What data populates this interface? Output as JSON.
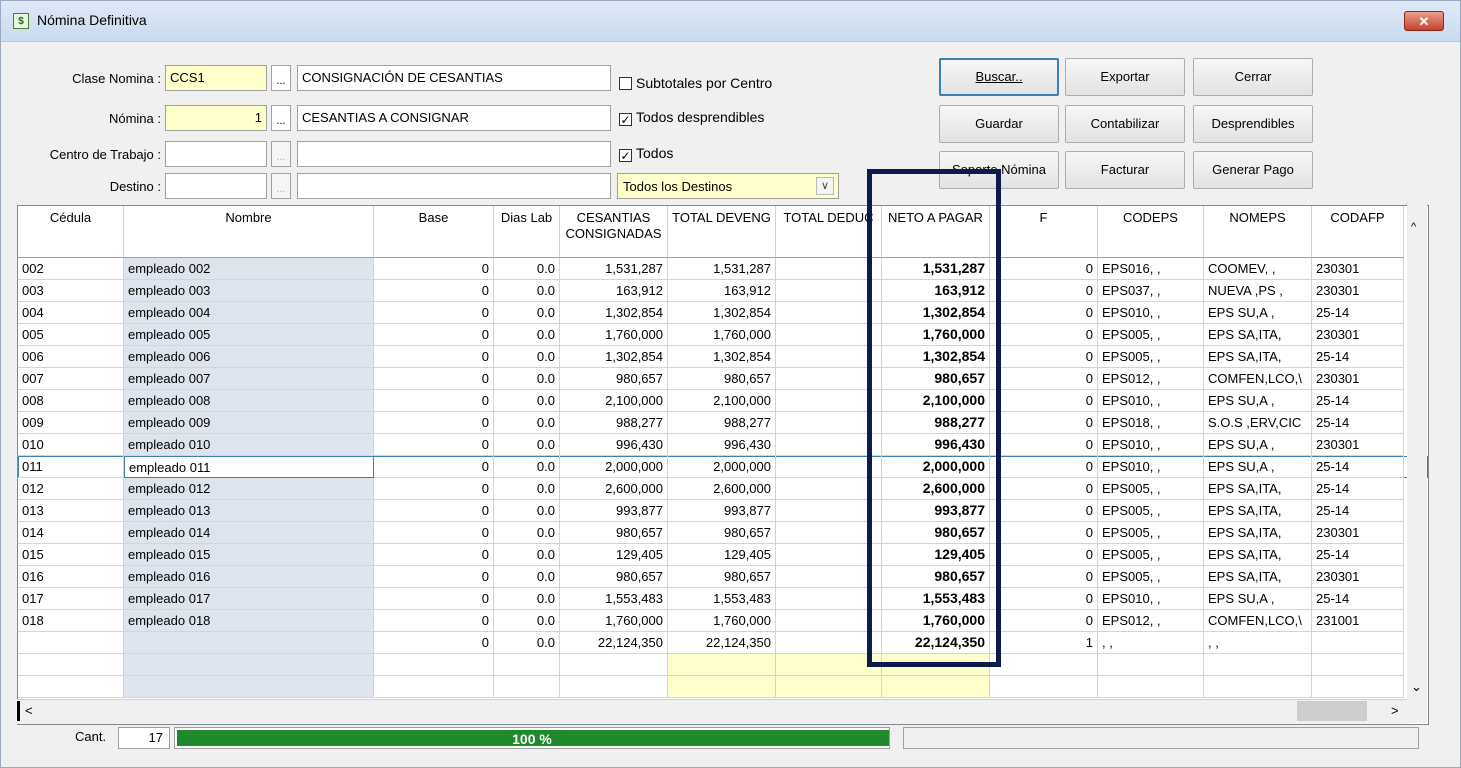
{
  "window": {
    "title": "Nómina Definitiva",
    "close_glyph": "✕"
  },
  "form": {
    "clase_label": "Clase Nomina :",
    "clase_code": "CCS1",
    "clase_desc": "CONSIGNACIÓN DE CESANTIAS",
    "nomina_label": "Nómina :",
    "nomina_code": "1",
    "nomina_desc": "CESANTIAS A CONSIGNAR",
    "centro_label": "Centro de Trabajo :",
    "centro_code": "",
    "centro_desc": "",
    "destino_label": "Destino :",
    "destino_code": "",
    "destino_desc": "",
    "dots": "...",
    "subtotales_label": "Subtotales por Centro",
    "subtotales_checked": false,
    "desprendibles_label": "Todos desprendibles",
    "desprendibles_checked": true,
    "todos_label": "Todos",
    "todos_checked": true,
    "destinos_value": "Todos los Destinos",
    "check_glyph": "✓"
  },
  "buttons": {
    "buscar": "Buscar..",
    "exportar": "Exportar",
    "cerrar": "Cerrar",
    "guardar": "Guardar",
    "contabilizar": "Contabilizar",
    "desprendibles": "Desprendibles",
    "soporte": "Soporte Nómina",
    "facturar": "Facturar",
    "generar_pago": "Generar Pago"
  },
  "table": {
    "columns": [
      "Cédula",
      "Nombre",
      "Base",
      "Dias Lab",
      "CESANTIAS\nCONSIGNADAS",
      "TOTAL DEVENG",
      "TOTAL DEDUC",
      "NETO A PAGAR",
      "F",
      "CODEPS",
      "NOMEPS",
      "CODAFP"
    ],
    "rows": [
      [
        "002",
        "empleado 002",
        "0",
        "0.0",
        "1,531,287",
        "1,531,287",
        "",
        "1,531,287",
        "0",
        "EPS016,  ,",
        "COOMEV,  ,",
        "230301"
      ],
      [
        "003",
        "empleado 003",
        "0",
        "0.0",
        "163,912",
        "163,912",
        "",
        "163,912",
        "0",
        "EPS037,  ,",
        "NUEVA ,PS ,",
        "230301"
      ],
      [
        "004",
        "empleado 004",
        "0",
        "0.0",
        "1,302,854",
        "1,302,854",
        "",
        "1,302,854",
        "0",
        "EPS010,  ,",
        "EPS SU,A ,",
        "25-14"
      ],
      [
        "005",
        "empleado 005",
        "0",
        "0.0",
        "1,760,000",
        "1,760,000",
        "",
        "1,760,000",
        "0",
        "EPS005,  ,",
        "EPS SA,ITA,",
        "230301"
      ],
      [
        "006",
        "empleado 006",
        "0",
        "0.0",
        "1,302,854",
        "1,302,854",
        "",
        "1,302,854",
        "0",
        "EPS005,  ,",
        "EPS SA,ITA,",
        "25-14"
      ],
      [
        "007",
        "empleado 007",
        "0",
        "0.0",
        "980,657",
        "980,657",
        "",
        "980,657",
        "0",
        "EPS012,  ,",
        "COMFEN,LCO,\\",
        "230301"
      ],
      [
        "008",
        "empleado 008",
        "0",
        "0.0",
        "2,100,000",
        "2,100,000",
        "",
        "2,100,000",
        "0",
        "EPS010,  ,",
        "EPS SU,A ,",
        "25-14"
      ],
      [
        "009",
        "empleado 009",
        "0",
        "0.0",
        "988,277",
        "988,277",
        "",
        "988,277",
        "0",
        "EPS018,  ,",
        "S.O.S ,ERV,CIC",
        "25-14"
      ],
      [
        "010",
        "empleado 010",
        "0",
        "0.0",
        "996,430",
        "996,430",
        "",
        "996,430",
        "0",
        "EPS010,  ,",
        "EPS SU,A ,",
        "230301"
      ],
      [
        "011",
        "empleado 011",
        "0",
        "0.0",
        "2,000,000",
        "2,000,000",
        "",
        "2,000,000",
        "0",
        "EPS010,  ,",
        "EPS SU,A ,",
        "25-14"
      ],
      [
        "012",
        "empleado 012",
        "0",
        "0.0",
        "2,600,000",
        "2,600,000",
        "",
        "2,600,000",
        "0",
        "EPS005,  ,",
        "EPS SA,ITA,",
        "25-14"
      ],
      [
        "013",
        "empleado 013",
        "0",
        "0.0",
        "993,877",
        "993,877",
        "",
        "993,877",
        "0",
        "EPS005,  ,",
        "EPS SA,ITA,",
        "25-14"
      ],
      [
        "014",
        "empleado 014",
        "0",
        "0.0",
        "980,657",
        "980,657",
        "",
        "980,657",
        "0",
        "EPS005,  ,",
        "EPS SA,ITA,",
        "230301"
      ],
      [
        "015",
        "empleado 015",
        "0",
        "0.0",
        "129,405",
        "129,405",
        "",
        "129,405",
        "0",
        "EPS005,  ,",
        "EPS SA,ITA,",
        "25-14"
      ],
      [
        "016",
        "empleado 016",
        "0",
        "0.0",
        "980,657",
        "980,657",
        "",
        "980,657",
        "0",
        "EPS005,  ,",
        "EPS SA,ITA,",
        "230301"
      ],
      [
        "017",
        "empleado 017",
        "0",
        "0.0",
        "1,553,483",
        "1,553,483",
        "",
        "1,553,483",
        "0",
        "EPS010,  ,",
        "EPS SU,A ,",
        "25-14"
      ],
      [
        "018",
        "empleado 018",
        "0",
        "0.0",
        "1,760,000",
        "1,760,000",
        "",
        "1,760,000",
        "0",
        "EPS012,  ,",
        "COMFEN,LCO,\\",
        "231001"
      ]
    ],
    "totals": [
      "",
      "",
      "0",
      "0.0",
      "22,124,350",
      "22,124,350",
      "",
      "22,124,350",
      "1",
      ",  ,",
      ",  ,",
      ""
    ],
    "selected_row": 9
  },
  "scroll": {
    "up": "▲",
    "down": "⌄",
    "left": "<",
    "right": ">"
  },
  "status": {
    "cant_label": "Cant.",
    "cant_value": "17",
    "progress_text": "100 %",
    "progress_fraction": 1.0
  }
}
